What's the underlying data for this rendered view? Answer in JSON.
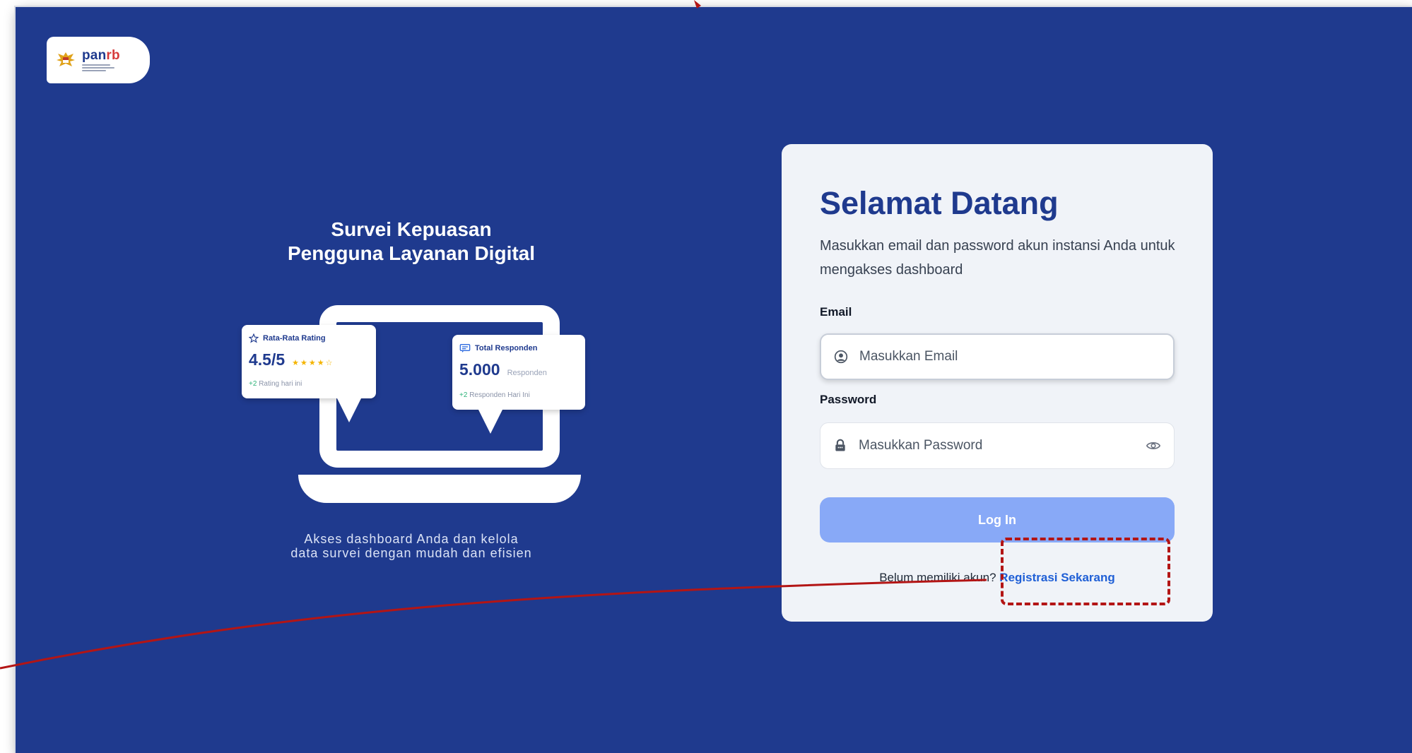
{
  "logo": {
    "brand_main": "pan",
    "brand_accent": "rb"
  },
  "hero": {
    "title_line1": "Survei Kepuasan",
    "title_line2": "Pengguna Layanan Digital",
    "subtitle_line1": "Akses dashboard Anda dan kelola",
    "subtitle_line2": "data survei dengan mudah dan efisien"
  },
  "rating_card": {
    "label": "Rata-Rata Rating",
    "value": "4.5/5",
    "stars": "★★★★☆",
    "stars_value": 4.5,
    "foot_delta": "+2",
    "foot_text": "Rating hari ini"
  },
  "respondent_card": {
    "label": "Total Responden",
    "value": "5.000",
    "unit": "Responden",
    "foot_delta": "+2",
    "foot_text": "Responden Hari Ini"
  },
  "login": {
    "title": "Selamat Datang",
    "description": "Masukkan email dan password akun instansi Anda untuk mengakses dashboard",
    "email_label": "Email",
    "email_placeholder": "Masukkan Email",
    "password_label": "Password",
    "password_placeholder": "Masukkan Password",
    "button_label": "Log In",
    "register_prompt": "Belum memiliki akun?",
    "register_link": "Registrasi Sekarang"
  },
  "colors": {
    "background": "#1f3a8e",
    "panel": "#f0f3f8",
    "title": "#1f3a8e",
    "button": "#88a9f7",
    "link": "#1f5fd6",
    "annotation": "#b31515"
  },
  "icons": {
    "user": "user-circle-icon",
    "lock": "lock-icon",
    "eye": "eye-icon",
    "star": "star-outline-icon",
    "chat": "chat-icon"
  }
}
